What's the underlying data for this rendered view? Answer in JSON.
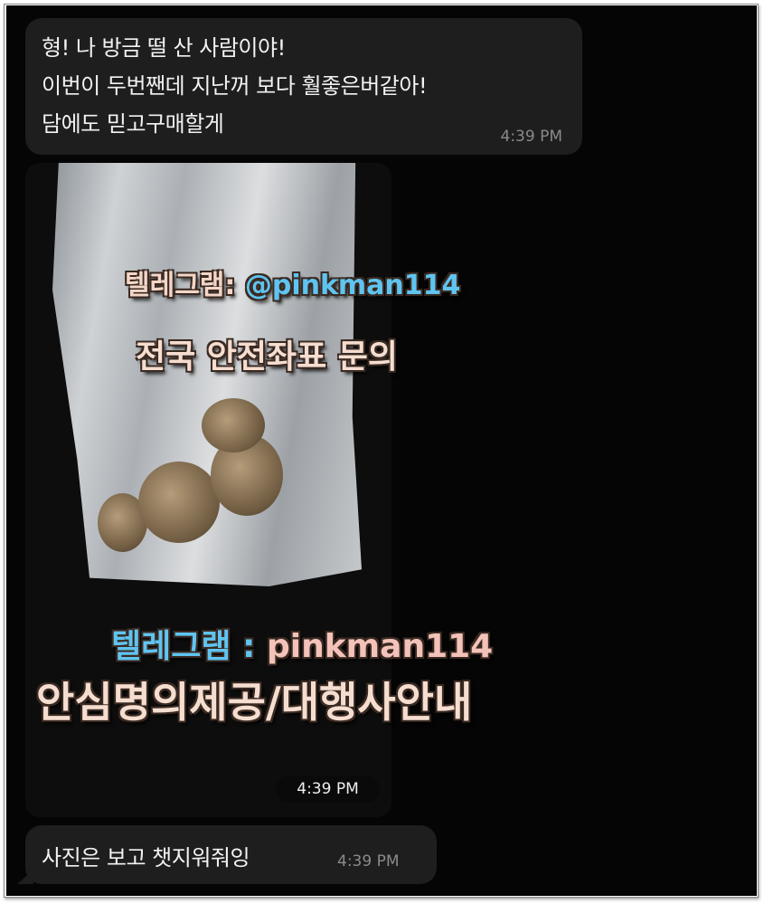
{
  "messages": [
    {
      "lines": [
        "형! 나 방금 떨 산 사람이야!",
        "이번이 두번짼데 지난꺼 보다 훨좋은버같아!",
        "담에도 믿고구매할게"
      ],
      "time": "4:39 PM"
    },
    {
      "type": "photo",
      "overlay": {
        "line1_label": "텔레그램:",
        "line1_handle": "@pinkman114",
        "line2": "전국 안전좌표 문의",
        "line3_label": "텔레그램 :",
        "line3_handle": "pinkman114",
        "line4": "안심명의제공/대행사안내"
      },
      "time": "4:39 PM"
    },
    {
      "lines": [
        "사진은 보고 챗지워줘잉"
      ],
      "time": "4:39 PM"
    }
  ],
  "colors": {
    "bubble": "#1e1e1e",
    "background": "#050505",
    "handle_blue": "#5fc4f0",
    "handle_pink": "#f3c2b8"
  }
}
